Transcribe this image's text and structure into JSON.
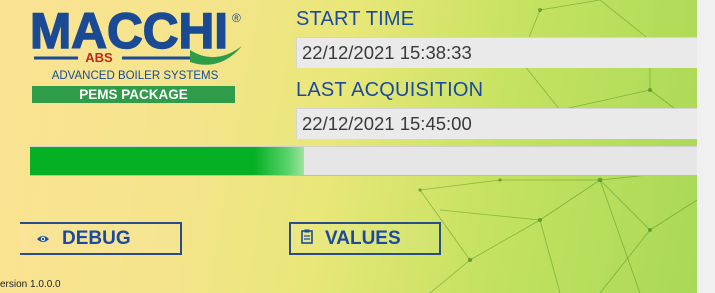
{
  "logo": {
    "brand": "MACCHI",
    "registered_mark": "®",
    "abs": "ABS",
    "subtitle": "ADVANCED BOILER SYSTEMS",
    "package": "PEMS PACKAGE"
  },
  "start_time": {
    "label": "START TIME",
    "value": "22/12/2021 15:38:33"
  },
  "last_acquisition": {
    "label": "LAST ACQUISITION",
    "value": "22/12/2021 15:45:00"
  },
  "progress": {
    "fraction": 0.41,
    "color": "#06b025"
  },
  "buttons": {
    "debug": {
      "label": "DEBUG",
      "icon": "eye-icon"
    },
    "values": {
      "label": "VALUES",
      "icon": "clipboard-icon"
    }
  },
  "version": "ersion 1.0.0.0",
  "colors": {
    "brand_blue": "#1a4a94",
    "label_blue": "#1c4aa0",
    "brand_red": "#c2281d",
    "pems_green": "#2e9c49"
  }
}
